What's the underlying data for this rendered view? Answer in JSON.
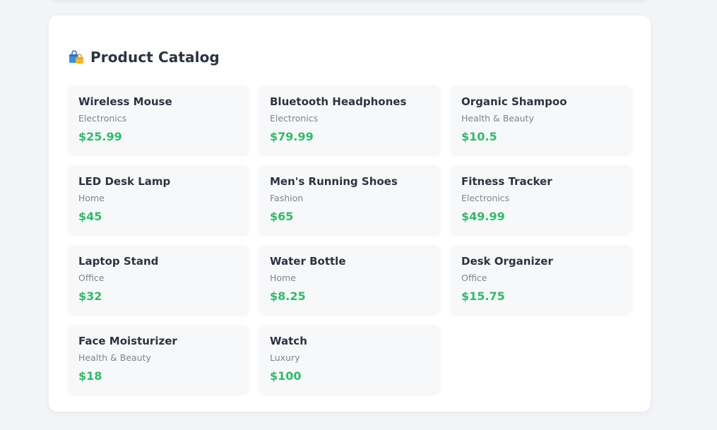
{
  "catalog": {
    "title": "Product Catalog",
    "icon": "shopping-bags-icon",
    "accent_color": "#2ebd68",
    "products": [
      {
        "name": "Wireless Mouse",
        "category": "Electronics",
        "price": "$25.99"
      },
      {
        "name": "Bluetooth Headphones",
        "category": "Electronics",
        "price": "$79.99"
      },
      {
        "name": "Organic Shampoo",
        "category": "Health & Beauty",
        "price": "$10.5"
      },
      {
        "name": "LED Desk Lamp",
        "category": "Home",
        "price": "$45"
      },
      {
        "name": "Men's Running Shoes",
        "category": "Fashion",
        "price": "$65"
      },
      {
        "name": "Fitness Tracker",
        "category": "Electronics",
        "price": "$49.99"
      },
      {
        "name": "Laptop Stand",
        "category": "Office",
        "price": "$32"
      },
      {
        "name": "Water Bottle",
        "category": "Home",
        "price": "$8.25"
      },
      {
        "name": "Desk Organizer",
        "category": "Office",
        "price": "$15.75"
      },
      {
        "name": "Face Moisturizer",
        "category": "Health & Beauty",
        "price": "$18"
      },
      {
        "name": "Watch",
        "category": "Luxury",
        "price": "$100"
      }
    ]
  }
}
